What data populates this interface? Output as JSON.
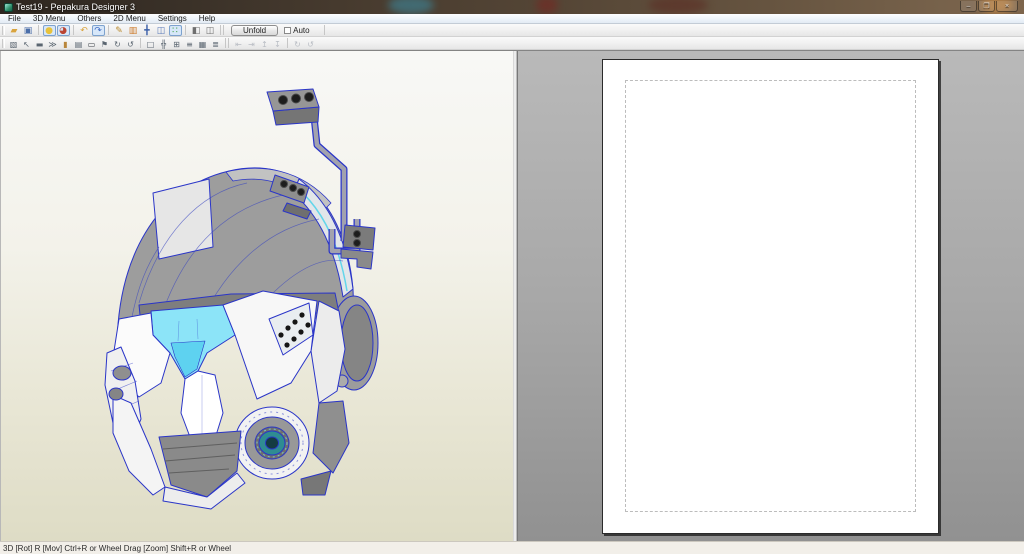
{
  "window": {
    "title": "Test19 - Pepakura Designer 3",
    "controls": [
      {
        "name": "minimize-button",
        "glyph": "–"
      },
      {
        "name": "maximize-button",
        "glyph": "❐"
      },
      {
        "name": "close-button",
        "glyph": "×"
      }
    ]
  },
  "menu": {
    "items": [
      "File",
      "3D Menu",
      "Others",
      "2D Menu",
      "Settings",
      "Help"
    ]
  },
  "toolbar_main": {
    "unfold_label": "Unfold",
    "auto_label": "Auto",
    "auto_checked": false,
    "icons": [
      {
        "name": "open-file-icon",
        "glyph": "▰",
        "color": "#d9a43e"
      },
      {
        "name": "save-file-icon",
        "glyph": "▣",
        "color": "#4a6ea9"
      },
      {
        "name": "light-render-icon",
        "glyph": "●",
        "color": "#e8c23a",
        "pressed": true,
        "sep": 1
      },
      {
        "name": "texture-sphere-icon",
        "glyph": "◕",
        "color": "#bb4433",
        "pressed": true
      },
      {
        "name": "view-reset-icon",
        "glyph": "↶",
        "color": "#d9a43e",
        "sep": 1
      },
      {
        "name": "view-rotate-icon",
        "glyph": "↷",
        "color": "#3f6bc4",
        "pressed": true
      },
      {
        "name": "edit-pencil-icon",
        "glyph": "✎",
        "color": "#b98a2e",
        "sep": 1
      },
      {
        "name": "texture-box-icon",
        "glyph": "▥",
        "color": "#cc7a2a"
      },
      {
        "name": "move-model-icon",
        "glyph": "╋",
        "color": "#3a5fa8"
      },
      {
        "name": "window-view-icon",
        "glyph": "◫",
        "color": "#5a7ab8"
      },
      {
        "name": "vertex-select-icon",
        "glyph": "∷",
        "color": "#3f9e3f",
        "pressed": true
      },
      {
        "name": "layout-3d-pane-icon",
        "glyph": "◧",
        "color": "#6f6f6f",
        "sep": 1
      },
      {
        "name": "layout-both-panes-icon",
        "glyph": "◫",
        "color": "#6f6f6f"
      }
    ]
  },
  "toolbar_edit": {
    "icons": [
      {
        "name": "check-repair-icon",
        "glyph": "▧",
        "color": "#5a6570"
      },
      {
        "name": "pick-tool-icon",
        "glyph": "↖",
        "color": "#5a6570"
      },
      {
        "name": "display-mode-icon",
        "glyph": "▬",
        "color": "#5a6570"
      },
      {
        "name": "scale-factor-icon",
        "glyph": "≫",
        "color": "#5a6570"
      },
      {
        "name": "material-icon",
        "glyph": "▮",
        "color": "#b8863b"
      },
      {
        "name": "pages-setup-icon",
        "glyph": "▤",
        "color": "#5a6570"
      },
      {
        "name": "pattern-view-icon",
        "glyph": "▭",
        "color": "#3a3f46"
      },
      {
        "name": "flag-marker-icon",
        "glyph": "⚑",
        "color": "#5a6570"
      },
      {
        "name": "rotate-cw-icon",
        "glyph": "↻",
        "color": "#5a6570"
      },
      {
        "name": "rotate-ccw-icon",
        "glyph": "↺",
        "color": "#5a6570"
      },
      {
        "name": "area-select-icon",
        "glyph": "□",
        "color": "#5a6570",
        "sep": 1
      },
      {
        "name": "divide-face-icon",
        "glyph": "╬",
        "color": "#5a6570"
      },
      {
        "name": "join-face-icon",
        "glyph": "⊞",
        "color": "#5a6570"
      },
      {
        "name": "part-order-icon",
        "glyph": "≡",
        "color": "#5a6570"
      },
      {
        "name": "grid-layout-icon",
        "glyph": "▦",
        "color": "#5a6570"
      },
      {
        "name": "print-range-icon",
        "glyph": "≣",
        "color": "#5a6570"
      },
      {
        "name": "align-left-icon",
        "glyph": "⇤",
        "color": "#b9bdc4",
        "disabled": true,
        "sep": 2
      },
      {
        "name": "align-right-icon",
        "glyph": "⇥",
        "color": "#b9bdc4",
        "disabled": true
      },
      {
        "name": "align-top-icon",
        "glyph": "↥",
        "color": "#b9bdc4",
        "disabled": true
      },
      {
        "name": "align-bottom-icon",
        "glyph": "↧",
        "color": "#b9bdc4",
        "disabled": true
      },
      {
        "name": "rotate-part-cw-icon",
        "glyph": "↻",
        "color": "#b9bdc4",
        "disabled": true,
        "sep": 1
      },
      {
        "name": "rotate-part-ccw-icon",
        "glyph": "↺",
        "color": "#b9bdc4",
        "disabled": true
      }
    ]
  },
  "status_bar": {
    "text": "3D [Rot] R [Mov] Ctrl+R or Wheel Drag [Zoom] Shift+R or Wheel"
  },
  "colors": {
    "pressed_bg": "#d7e7f9",
    "pressed_border": "#7da2ce",
    "visor_cyan": "#8ce4f8",
    "model_gray": "#9d9d9d",
    "wireframe_blue": "#2a35c8",
    "pane2d_gray": "#a8a8a8",
    "page_white": "#ffffff"
  }
}
